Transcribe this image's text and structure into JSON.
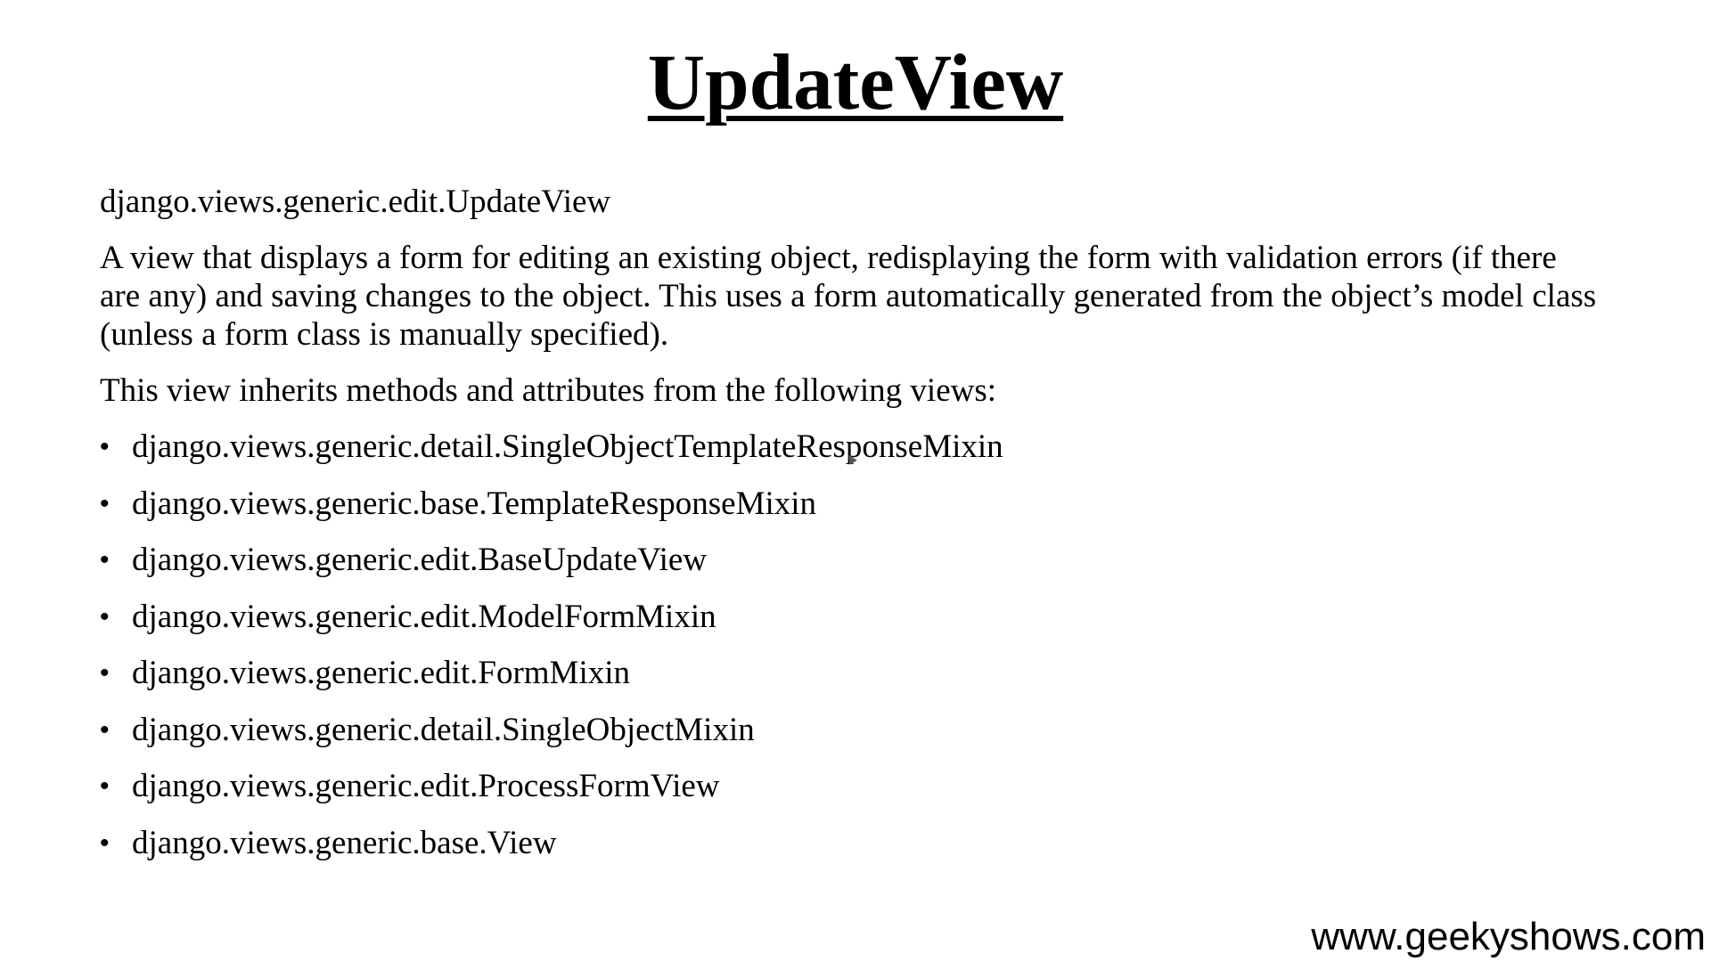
{
  "slide": {
    "title": "UpdateView",
    "module_path": "django.views.generic.edit.UpdateView",
    "description": "A view that displays a form for editing an existing object, redisplaying the form with validation errors (if there are any) and saving changes to the object. This uses a form automatically generated from the object’s model class (unless a form class is manually specified).",
    "inherit_intro": "This view inherits methods and attributes from the following views:",
    "bullet_char": "•",
    "bases": [
      "django.views.generic.detail.SingleObjectTemplateResponseMixin",
      "django.views.generic.base.TemplateResponseMixin",
      "django.views.generic.edit.BaseUpdateView",
      "django.views.generic.edit.ModelFormMixin",
      "django.views.generic.edit.FormMixin",
      "django.views.generic.detail.SingleObjectMixin",
      "django.views.generic.edit.ProcessFormView",
      "django.views.generic.base.View"
    ]
  },
  "watermark": {
    "text": "www.geekyshows.com"
  }
}
